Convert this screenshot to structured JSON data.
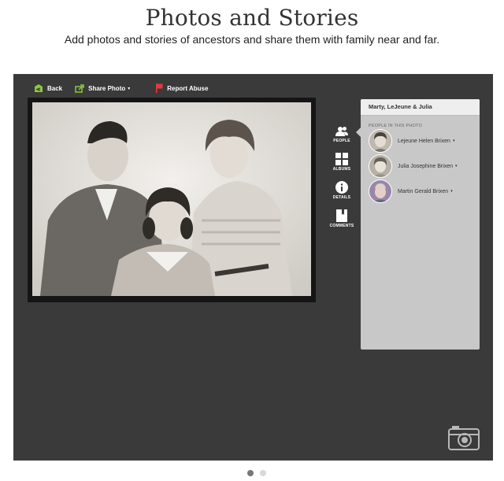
{
  "header": {
    "title": "Photos and Stories",
    "subtitle": "Add photos and stories of ancestors and share them with family near and far."
  },
  "toolbar": {
    "back_label": "Back",
    "share_label": "Share Photo",
    "share_caret": "▾",
    "report_label": "Report Abuse"
  },
  "side_tools": [
    {
      "label": "PEOPLE",
      "icon": "people-icon"
    },
    {
      "label": "ALBUMS",
      "icon": "albums-icon"
    },
    {
      "label": "DETAILS",
      "icon": "info-icon"
    },
    {
      "label": "COMMENTS",
      "icon": "comments-icon"
    }
  ],
  "panel": {
    "title": "Marty, LeJeune & Julia",
    "section_label": "PEOPLE IN THIS PHOTO",
    "people": [
      {
        "name": "Lejeune Helen Brixen",
        "caret": "▾"
      },
      {
        "name": "Julia Josephine Brixen",
        "caret": "▾"
      },
      {
        "name": "Martin Gerald Brixen",
        "caret": "▾"
      }
    ]
  },
  "colors": {
    "stage_bg": "#3a3a3a",
    "panel_bg": "#c8c8c8",
    "toolbar_icon_green": "#8dc63f",
    "report_flag_red": "#e03a3e"
  }
}
